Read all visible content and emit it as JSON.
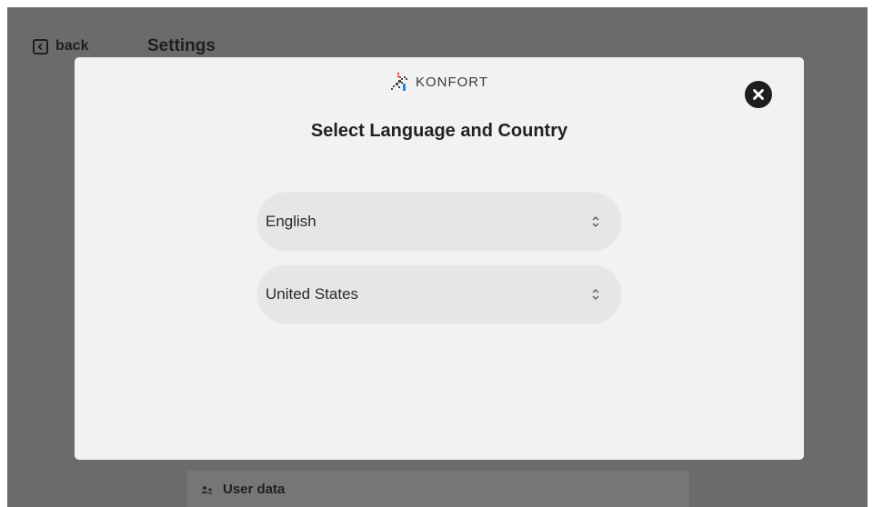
{
  "background": {
    "back_label": "back",
    "page_title": "Settings",
    "user_data_label": "User data"
  },
  "modal": {
    "logo_text": "KONFORT",
    "title": "Select Language and Country",
    "language": {
      "selected": "English"
    },
    "country": {
      "selected": "United States"
    }
  },
  "icons": {
    "back": "chevron-left-square-icon",
    "close": "close-circle-icon",
    "select": "up-down-chevron-icon",
    "user_data": "user-data-icon",
    "logo": "konfort-logo-mark"
  },
  "colors": {
    "overlay": "#6b6b6b",
    "modal_bg": "#f2f2f2",
    "field_bg": "#e6e6e6",
    "text_dark": "#222222",
    "logo_red": "#e53935",
    "logo_blue": "#1e88e5"
  }
}
